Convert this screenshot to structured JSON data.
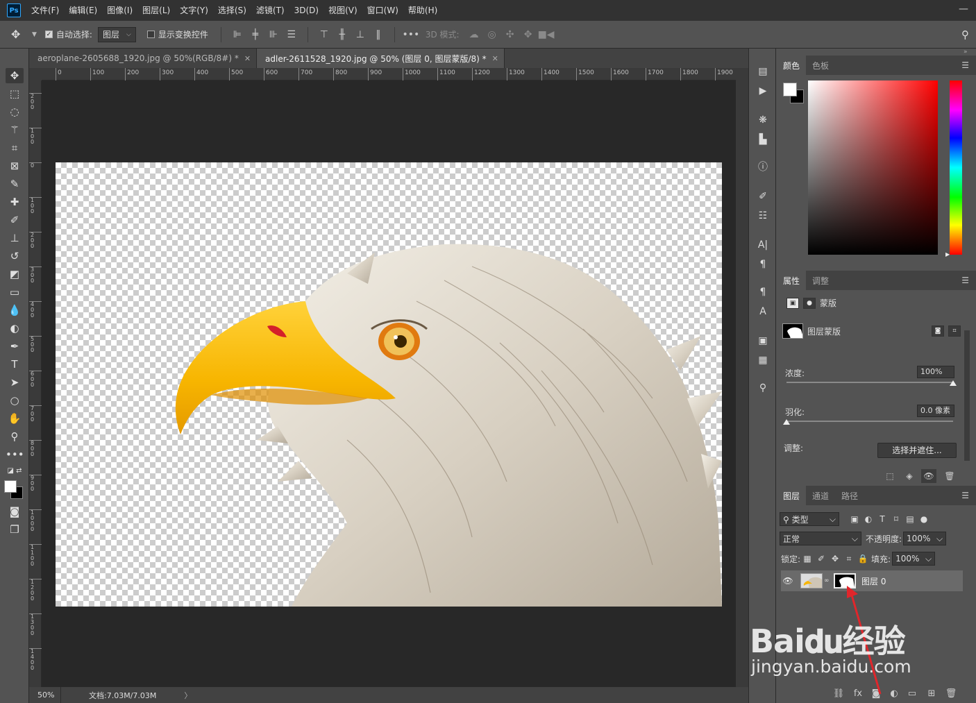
{
  "menu": {
    "logo": "Ps",
    "items": [
      "文件(F)",
      "编辑(E)",
      "图像(I)",
      "图层(L)",
      "文字(Y)",
      "选择(S)",
      "滤镜(T)",
      "3D(D)",
      "视图(V)",
      "窗口(W)",
      "帮助(H)"
    ],
    "window_control": "—"
  },
  "options": {
    "auto_select_label": "自动选择:",
    "auto_select_target": "图层",
    "show_transform_label": "显示变换控件",
    "mode_3d_label": "3D 模式:"
  },
  "tabs": [
    {
      "label": "aeroplane-2605688_1920.jpg @ 50%(RGB/8#) *",
      "active": false
    },
    {
      "label": "adler-2611528_1920.jpg @ 50% (图层 0, 图层蒙版/8) *",
      "active": true
    }
  ],
  "ruler": {
    "h_ticks": [
      "0",
      "100",
      "200",
      "300",
      "400",
      "500",
      "600",
      "700",
      "800",
      "900",
      "1000",
      "1100",
      "1200",
      "1300",
      "1400",
      "1500",
      "1600",
      "1700",
      "1800",
      "1900"
    ],
    "v_ticks": [
      "2\n0\n0",
      "1\n0\n0",
      "0",
      "1\n0\n0",
      "2\n0\n0",
      "3\n0\n0",
      "4\n0\n0",
      "5\n0\n0",
      "6\n0\n0",
      "7\n0\n0",
      "8\n0\n0",
      "9\n0\n0",
      "1\n0\n0\n0",
      "1\n1\n0\n0",
      "1\n2\n0\n0",
      "1\n3\n0\n0",
      "1\n4\n0\n0"
    ]
  },
  "status": {
    "zoom": "50%",
    "doc_info": "文档:7.03M/7.03M",
    "arrow": "〉"
  },
  "color_panel": {
    "tabs": [
      "颜色",
      "色板"
    ]
  },
  "properties_panel": {
    "tabs": [
      "属性",
      "调整"
    ],
    "mask_type_label": "蒙版",
    "layer_mask_label": "图层蒙版",
    "density_label": "浓度:",
    "density_value": "100%",
    "density_fraction": 1.0,
    "feather_label": "羽化:",
    "feather_value": "0.0 像素",
    "feather_fraction": 0.0,
    "adjust_label": "调整:",
    "select_mask_button": "选择并遮住..."
  },
  "layers_panel": {
    "tabs": [
      "图层",
      "通道",
      "路径"
    ],
    "filter_kind": "类型",
    "blend_mode": "正常",
    "opacity_label": "不透明度:",
    "opacity_value": "100%",
    "lock_label": "锁定:",
    "fill_label": "填充:",
    "fill_value": "100%",
    "layers": [
      {
        "name": "图层 0",
        "visible": true,
        "has_mask": true
      }
    ]
  },
  "watermark": {
    "main": "Bai𝐝𝐮经验",
    "sub": "jingyan.baidu.com"
  },
  "icons": {
    "move": "move-icon",
    "marquee": "marquee-icon",
    "lasso": "lasso-icon",
    "magic_wand": "magic-wand-icon",
    "crop": "crop-icon",
    "frame": "frame-icon",
    "eyedropper": "eyedropper-icon",
    "patch": "healing-icon",
    "brush": "brush-icon",
    "stamp": "clone-stamp-icon",
    "history_brush": "history-brush-icon",
    "eraser": "eraser-icon",
    "gradient": "gradient-icon",
    "blur": "blur-icon",
    "dodge": "dodge-icon",
    "pen": "pen-icon",
    "type": "type-icon",
    "path_select": "path-selection-icon",
    "shape": "ellipse-icon",
    "hand": "hand-icon",
    "zoom": "zoom-icon"
  }
}
